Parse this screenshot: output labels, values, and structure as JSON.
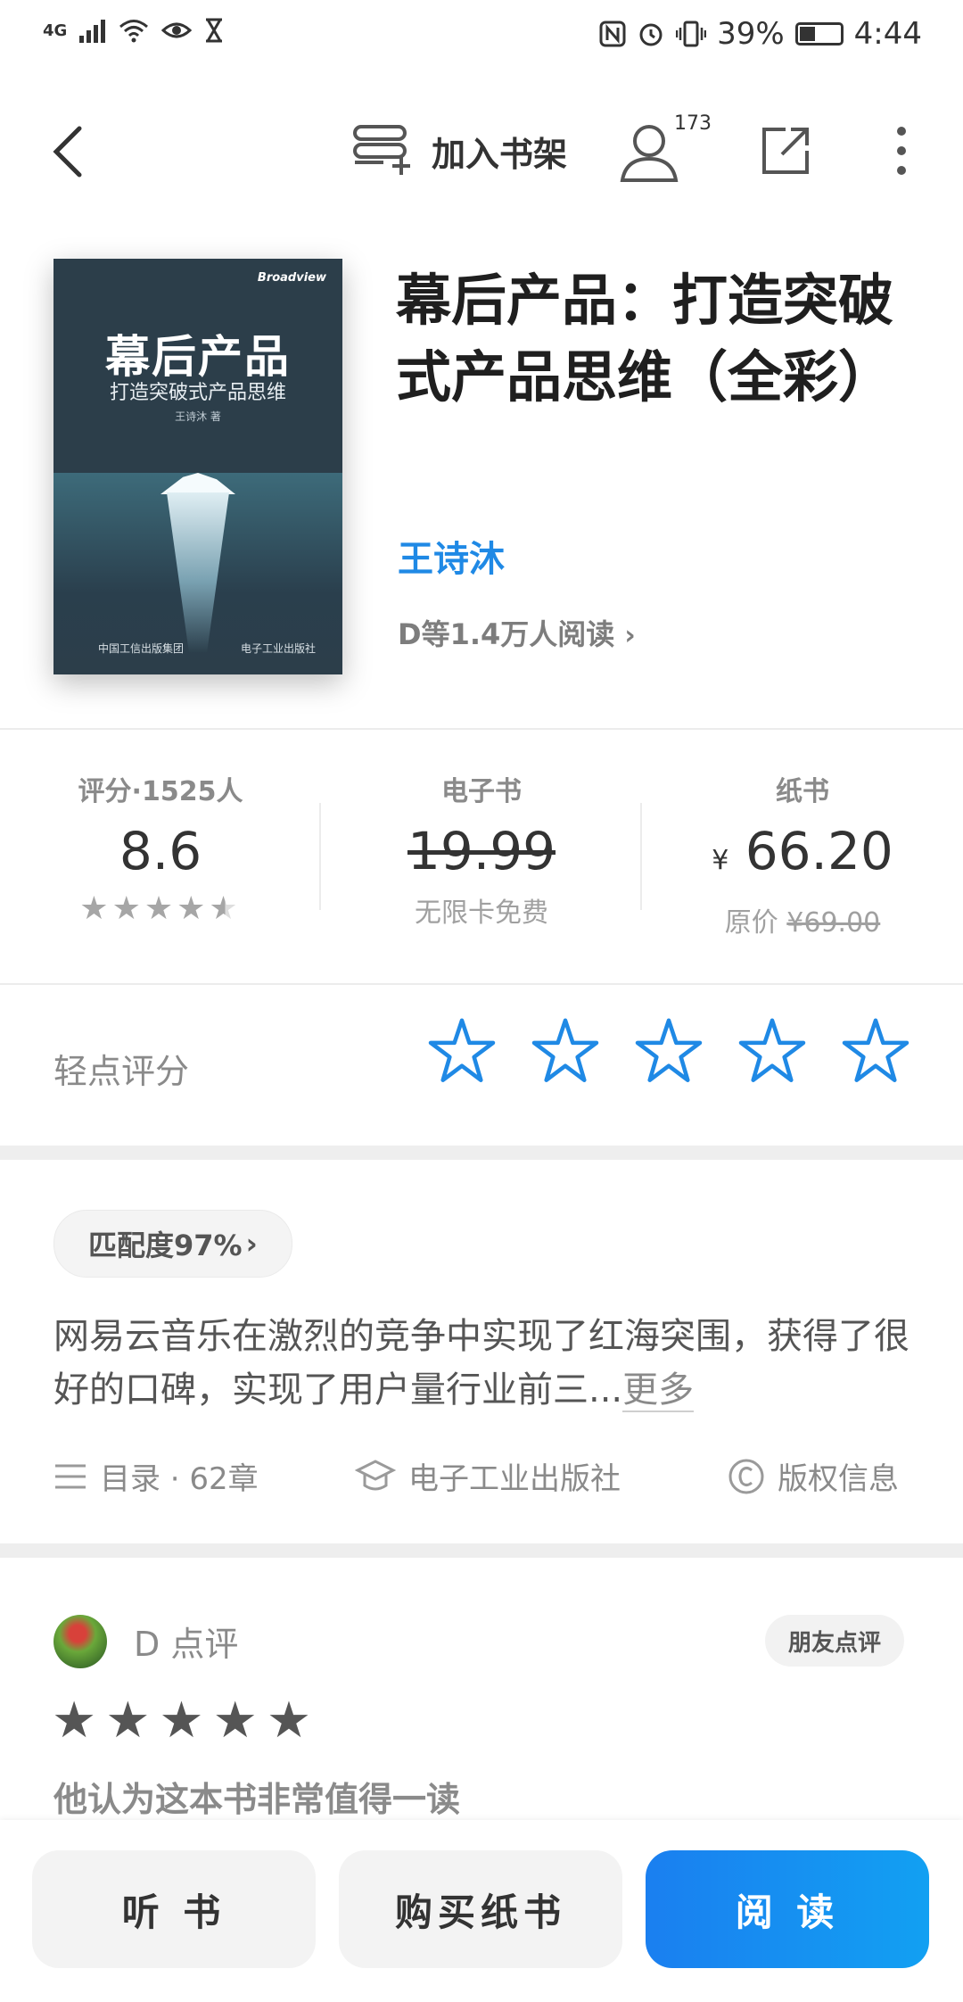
{
  "status_bar": {
    "network": "4G",
    "battery": "39%",
    "battery_level": 0.39,
    "time": "4:44"
  },
  "nav": {
    "add_to_shelf": "加入书架",
    "follow_count": "173"
  },
  "book": {
    "title": "幕后产品：打造突破式产品思维（全彩）",
    "author": "王诗沐",
    "readers": "D等1.4万人阅读",
    "cover": {
      "brand": "Broadview",
      "title": "幕后产品",
      "subtitle": "打造突破式产品思维",
      "author": "王诗沐 著",
      "publisher_left": "中国工信出版集团",
      "publisher_right": "电子工业出版社"
    }
  },
  "stats": {
    "rating_label": "评分·1525人",
    "rating_value": "8.6",
    "rating_stars": 4.5,
    "ebook_label": "电子书",
    "ebook_price": "19.99",
    "ebook_note": "无限卡免费",
    "paper_label": "纸书",
    "paper_currency": "¥",
    "paper_price": "66.20",
    "paper_original_label": "原价",
    "paper_original_price": "¥69.00"
  },
  "rate": {
    "label": "轻点评分",
    "star_color": "#1f89e5"
  },
  "detail": {
    "match": "匹配度97%",
    "description": "网易云音乐在激烈的竞争中实现了红海突围，获得了很好的口碑，实现了用户量行业前三...",
    "more": "更多",
    "toc": "目录 · 62章",
    "publisher": "电子工业出版社",
    "copyright": "版权信息"
  },
  "review": {
    "name": "D 点评",
    "badge": "朋友点评",
    "stars": 5,
    "text": "他认为这本书非常值得一读"
  },
  "bottom": {
    "listen": "听 书",
    "buy_paper": "购买纸书",
    "read": "阅 读"
  },
  "colors": {
    "accent": "#1f89e5",
    "read_button": "#1a7ff0"
  }
}
